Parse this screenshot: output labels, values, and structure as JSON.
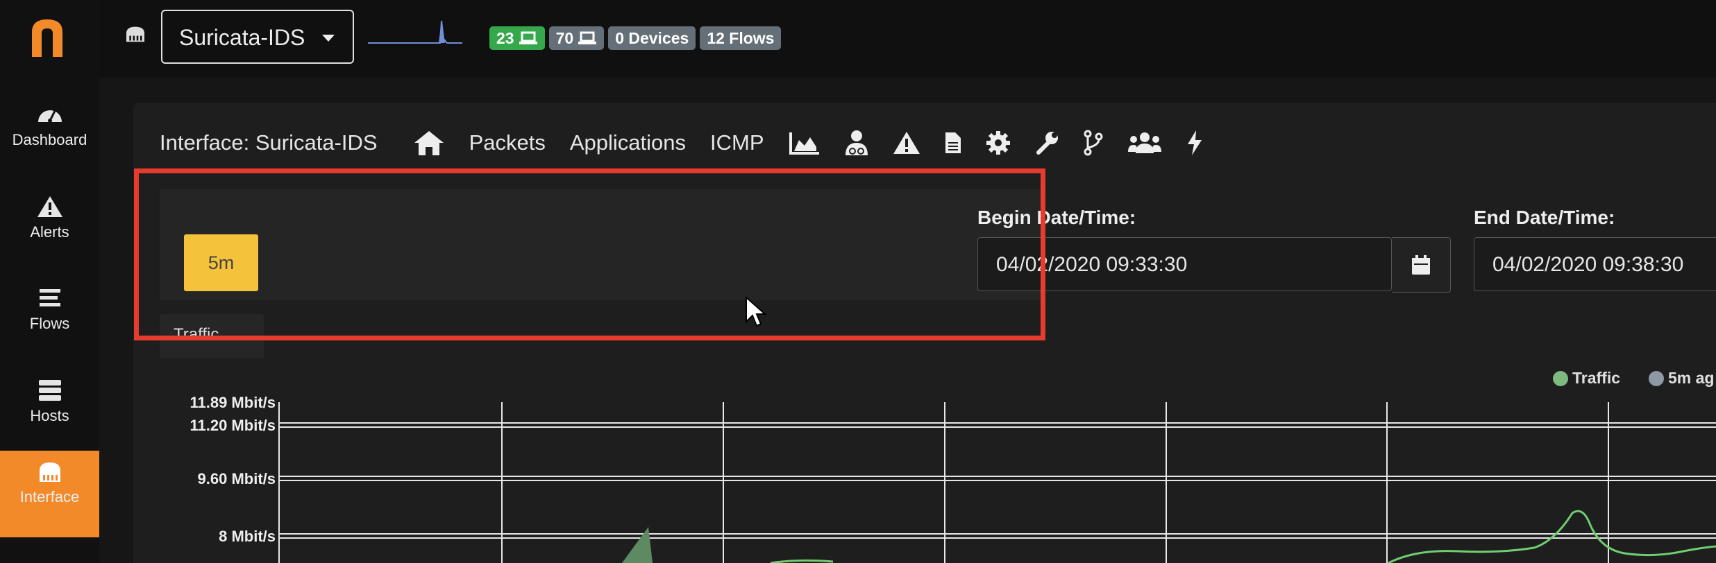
{
  "sidebar": {
    "items": [
      {
        "label": "Dashboard",
        "icon": "dashboard-gauge-icon"
      },
      {
        "label": "Alerts",
        "icon": "alert-triangle-icon"
      },
      {
        "label": "Flows",
        "icon": "flows-bars-icon"
      },
      {
        "label": "Hosts",
        "icon": "hosts-server-icon"
      },
      {
        "label": "Interface",
        "icon": "ethernet-icon",
        "active": true
      }
    ]
  },
  "topbar": {
    "interface_select": "Suricata-IDS",
    "badges": [
      {
        "count": "23",
        "icon": "laptop-icon",
        "color": "#35a84b"
      },
      {
        "count": "70",
        "icon": "laptop-icon",
        "color": "#646f77"
      },
      {
        "text": "0 Devices",
        "color": "#646f77"
      },
      {
        "text": "12 Flows",
        "color": "#646f77"
      }
    ]
  },
  "nav": {
    "title": "Interface: Suricata-IDS",
    "links": [
      "Packets",
      "Applications",
      "ICMP"
    ],
    "icons": [
      "home-icon",
      "area-chart-icon",
      "user-doctor-icon",
      "warning-icon",
      "file-icon",
      "gear-icon",
      "wrench-icon",
      "code-branch-icon",
      "users-icon",
      "bolt-icon"
    ]
  },
  "time_range": {
    "selected_preset": "5m",
    "begin_label": "Begin Date/Time:",
    "begin_value": "04/02/2020 09:33:30",
    "end_label": "End Date/Time:",
    "end_value": "04/02/2020 09:38:30"
  },
  "metric_select": "Traffic",
  "legend": [
    {
      "name": "Traffic",
      "color": "#7dba7f"
    },
    {
      "name": "5m ag",
      "color": "#8e99a4"
    }
  ],
  "accent_color": "#f38a2a",
  "highlight_color": "#e53c2e",
  "chart_data": {
    "type": "line",
    "title": "",
    "xlabel": "",
    "ylabel": "",
    "y_ticks": [
      "11.89 Mbit/s",
      "11.20 Mbit/s",
      "9.60 Mbit/s",
      "8 Mbit/s"
    ],
    "ylim": [
      8,
      11.89
    ],
    "series": [
      {
        "name": "Traffic",
        "color": "#7dba7f"
      },
      {
        "name": "5m ag",
        "color": "#8e99a4"
      }
    ],
    "grid": true
  }
}
